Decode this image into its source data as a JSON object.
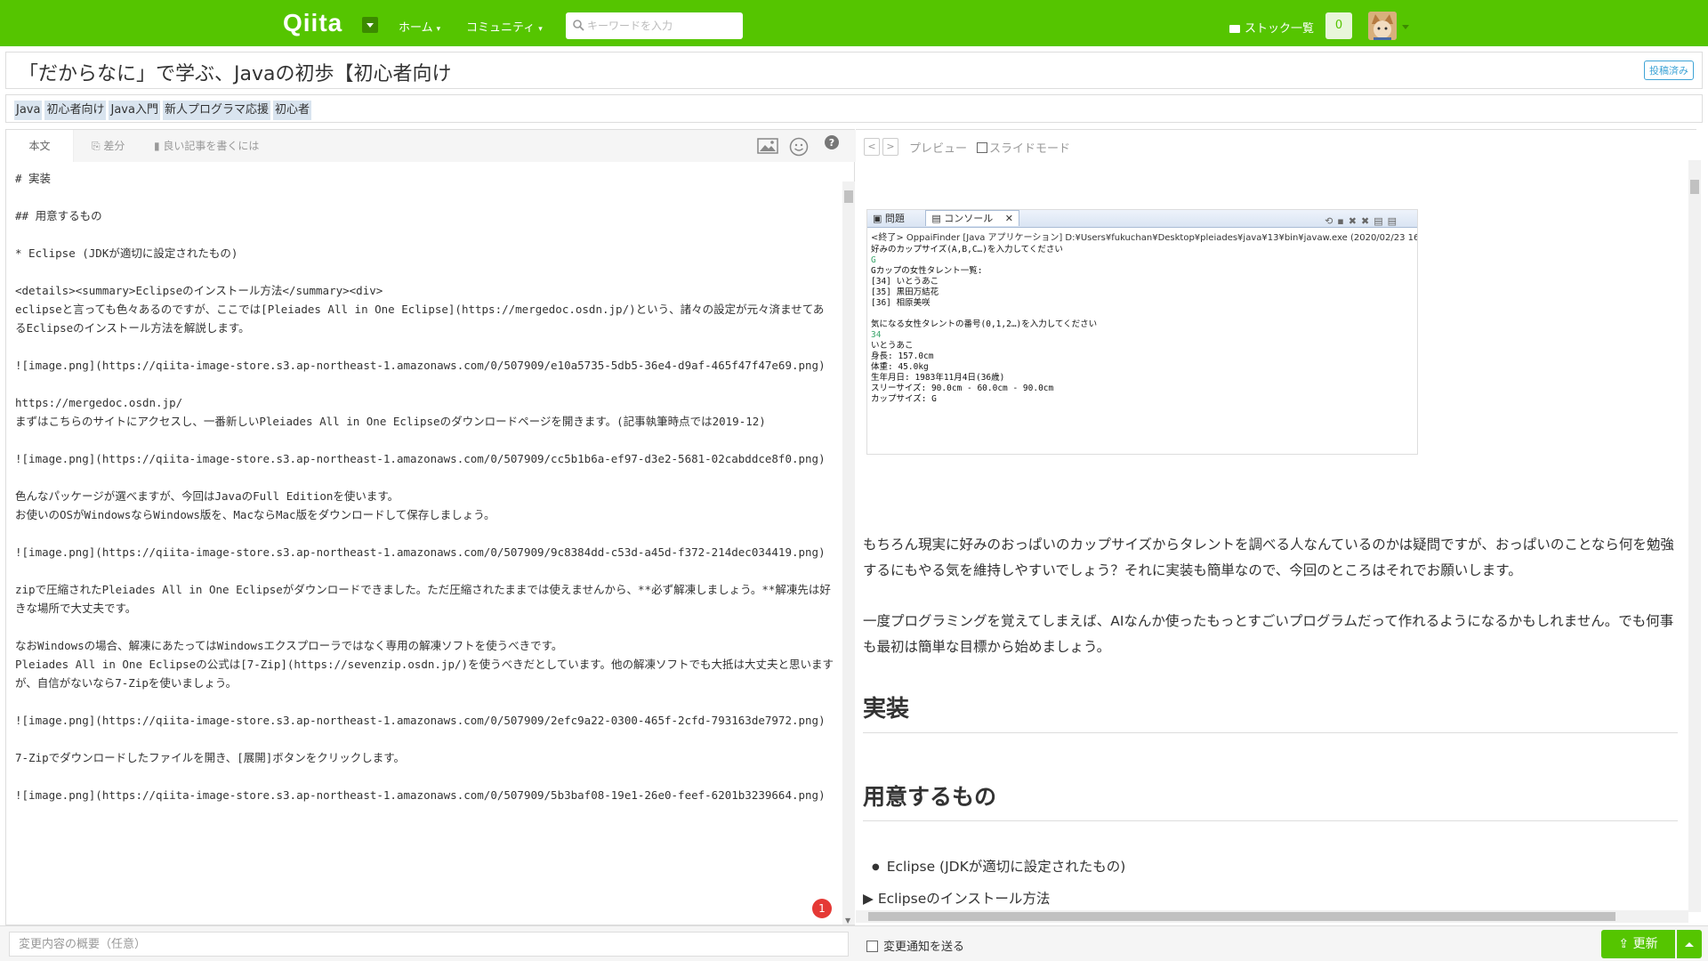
{
  "header": {
    "logo": "Qiita",
    "nav": [
      "ホーム",
      "コミュニティ"
    ],
    "search_placeholder": "キーワードを入力",
    "stock_label": "ストック一覧",
    "notification_count": "0",
    "brand_color": "#55c500"
  },
  "article": {
    "title": "「だからなに」で学ぶ、Javaの初歩【初心者向け",
    "posted_badge": "投稿済み",
    "tags": [
      "Java",
      "初心者向け",
      "Java入門",
      "新人プログラマ応援",
      "初心者"
    ]
  },
  "editor": {
    "tabs": [
      "本文",
      "差分",
      "良い記事を書くには"
    ],
    "tools": [
      "image-icon",
      "emoji-icon",
      "help-icon"
    ],
    "lines": [
      "# 実装",
      "",
      "## 用意するもの",
      "",
      "* Eclipse (JDKが適切に設定されたもの)",
      "",
      "<details><summary>Eclipseのインストール方法</summary><div>",
      "eclipseと言っても色々あるのですが、ここでは[Pleiades All in One Eclipse](https://mergedoc.osdn.jp/)という、諸々の設定が元々済ませてあるEclipseのインストール方法を解説します。",
      "",
      "![image.png](https://qiita-image-store.s3.ap-northeast-1.amazonaws.com/0/507909/e10a5735-5db5-36e4-d9af-465f47f47e69.png)",
      "",
      "https://mergedoc.osdn.jp/",
      "まずはこちらのサイトにアクセスし、一番新しいPleiades All in One Eclipseのダウンロードページを開きます。(記事執筆時点では2019-12)",
      "",
      "![image.png](https://qiita-image-store.s3.ap-northeast-1.amazonaws.com/0/507909/cc5b1b6a-ef97-d3e2-5681-02cabddce8f0.png)",
      "",
      "色んなパッケージが選べますが、今回はJavaのFull Editionを使います。",
      "お使いのOSがWindowsならWindows版を、MacならMac版をダウンロードして保存しましょう。",
      "",
      "![image.png](https://qiita-image-store.s3.ap-northeast-1.amazonaws.com/0/507909/9c8384dd-c53d-a45d-f372-214dec034419.png)",
      "",
      "zipで圧縮されたPleiades All in One Eclipseがダウンロードできました。ただ圧縮されたままでは使えませんから、**必ず解凍しましょう。**解凍先は好きな場所で大丈夫です。",
      "",
      "なおWindowsの場合、解凍にあたってはWindowsエクスプローラではなく専用の解凍ソフトを使うべきです。",
      "Pleiades All in One Eclipseの公式は[7-Zip](https://sevenzip.osdn.jp/)を使うべきだとしています。他の解凍ソフトでも大抵は大丈夫と思いますが、自信がないなら7-Zipを使いましょう。",
      "",
      "![image.png](https://qiita-image-store.s3.ap-northeast-1.amazonaws.com/0/507909/2efc9a22-0300-465f-2cfd-793163de7972.png)",
      "",
      "7-Zipでダウンロードしたファイルを開き、[展開]ボタンをクリックします。",
      "",
      "![image.png](https://qiita-image-store.s3.ap-northeast-1.amazonaws.com/0/507909/5b3baf08-19e1-26e0-feef-6201b3239664.png)"
    ],
    "error_count": "1"
  },
  "preview": {
    "label": "プレビュー",
    "slide_mode": "スライドモード",
    "console": {
      "tabs": [
        "問題",
        "コンソール"
      ],
      "path": "<終了> OppaiFinder [Java アプリケーション] D:¥Users¥fukuchan¥Desktop¥pleiades¥java¥13¥bin¥javaw.exe (2020/02/23 16",
      "output": [
        "好みのカップサイズ(A,B,C…)を入力してください",
        "G",
        "Gカップの女性タレント一覧:",
        "[34] いとうあこ",
        "[35] 黒田万結花",
        "[36] 相原美咲",
        "",
        "気になる女性タレントの番号(0,1,2…)を入力してください",
        "34",
        "いとうあこ",
        "身長: 157.0cm",
        "体重: 45.0kg",
        "生年月日: 1983年11月4日(36歳)",
        "スリーサイズ: 90.0cm - 60.0cm - 90.0cm",
        "カップサイズ: G"
      ]
    },
    "para1": "もちろん現実に好みのおっぱいのカップサイズからタレントを調べる人なんているのかは疑問ですが、おっぱいのことなら何を勉強するにもやる気を維持しやすいでしょう？それに実装も簡単なので、今回のところはそれでお願いします。",
    "para2": "一度プログラミングを覚えてしまえば、AIなんか使ったもっとすごいプログラムだって作れるようになるかもしれません。でも何事も最初は簡単な目標から始めましょう。",
    "h1": "実装",
    "h2": "用意するもの",
    "list_item": "Eclipse (JDKが適切に設定されたもの)",
    "details_summary": "Eclipseのインストール方法"
  },
  "footer": {
    "summary_placeholder": "変更内容の概要（任意）",
    "notify_label": "変更通知を送る",
    "update_label": "更新"
  }
}
